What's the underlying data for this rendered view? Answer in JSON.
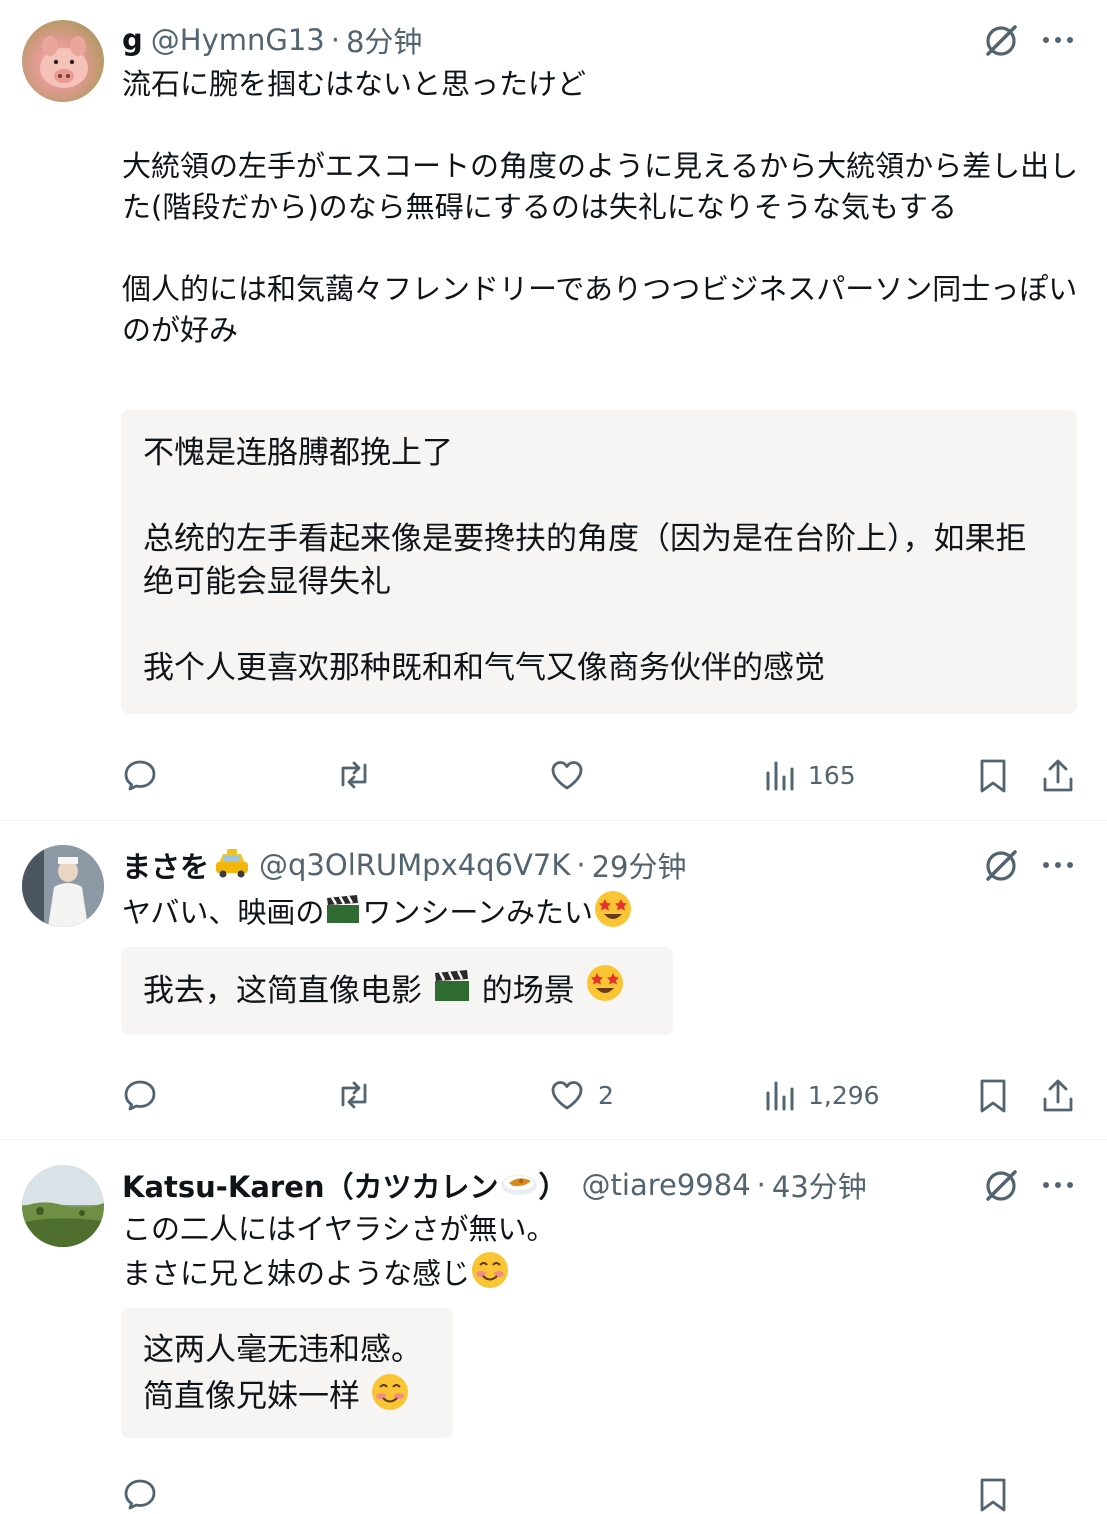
{
  "posts": [
    {
      "name": "g",
      "handle": "@HymnG13",
      "separator": "·",
      "time": "8分钟",
      "body": "流石に腕を掴むはないと思ったけど\n\n大統領の左手がエスコートの角度のように見えるから大統領から差し出した(階段だから)のなら無碍にするのは失礼になりそうな気もする\n\n個人的には和気藹々フレンドリーでありつつビジネスパーソン同士っぽいのが好み",
      "translation": "不愧是连胳膊都挽上了\n\n总统的左手看起来像是要搀扶的角度（因为是在台阶上），如果拒绝可能会显得失礼\n\n我个人更喜欢那种既和和气气又像商务伙伴的感觉",
      "likes": "",
      "views": "165"
    },
    {
      "name": "まさを",
      "handle": "@q3OlRUMpx4q6V7K",
      "separator": "·",
      "time": "29分钟",
      "body_before": "ヤバい、映画の",
      "body_mid": "ワンシーンみたい",
      "translation_before": "我去，这简直像电影 ",
      "translation_mid": " 的场景 ",
      "likes": "2",
      "views": "1,296"
    },
    {
      "name": "Katsu-Karen（カツカレン",
      "name_after": "）",
      "handle": "@tiare9984",
      "separator": "·",
      "time": "43分钟",
      "body_line1": "この二人にはイヤラシさが無い。",
      "body_line2": "まさに兄と妹のような感じ",
      "translation_line1": "这两人毫无违和感。",
      "translation_line2": "简直像兄妹一样 "
    }
  ],
  "icons": {
    "grok": "grok-icon",
    "more": "more-icon",
    "reply": "reply-icon",
    "repost": "repost-icon",
    "like": "like-icon",
    "views": "views-icon",
    "bookmark": "bookmark-icon",
    "share": "share-icon"
  },
  "colors": {
    "text": "#0f1419",
    "secondary": "#536471",
    "translation_bg": "#f7f5f3",
    "divider": "#eff3f4"
  }
}
